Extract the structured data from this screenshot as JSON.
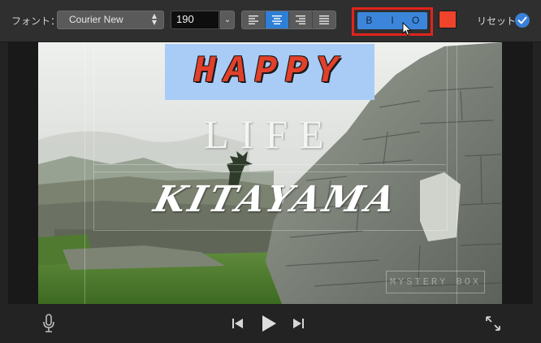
{
  "toolbar": {
    "font_label": "フォント：",
    "font_name": "Courier New",
    "font_size": "190",
    "align_options": [
      "align-left",
      "align-center",
      "align-right",
      "align-justify"
    ],
    "align_selected": "align-center",
    "style_buttons": [
      "B",
      "I",
      "O"
    ],
    "text_color": "#f0432c",
    "reset_label": "リセット"
  },
  "viewer": {
    "title_line_1": "HAPPY",
    "title_line_2": "LIFE",
    "title_line_3": "KITAYAMA",
    "watermark": "MYSTERY BOX",
    "colors": {
      "title_1": "#e2402a",
      "title_1_highlight": "#a9ccf7",
      "title_2": "#f4f4f4",
      "title_3": "#ffffff"
    }
  },
  "playback": {
    "icons": [
      "microphone-icon",
      "skip-back-icon",
      "play-icon",
      "skip-forward-icon",
      "fullscreen-icon"
    ]
  },
  "colors": {
    "accent": "#3b86db",
    "highlight_box": "#e0241c",
    "toolbar_bg": "#2f2f2f",
    "app_bg": "#232323"
  }
}
